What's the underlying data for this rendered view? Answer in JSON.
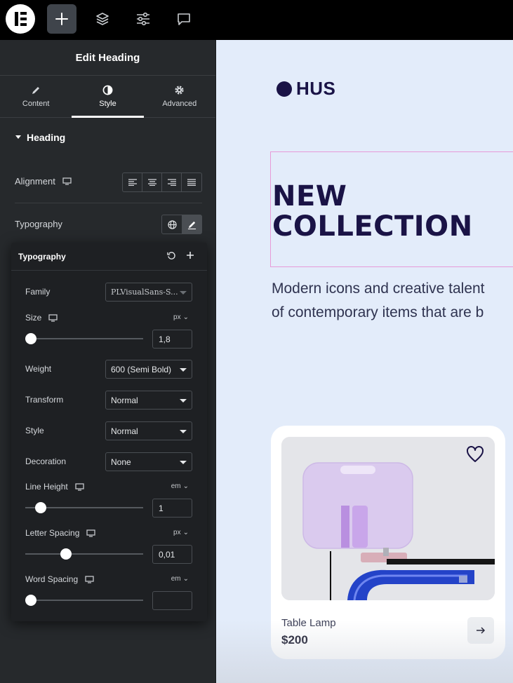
{
  "topbar": {
    "icons": [
      "elementor-logo-icon",
      "plus-icon",
      "layers-icon",
      "sliders-icon",
      "comment-icon"
    ]
  },
  "panel": {
    "title": "Edit Heading",
    "tabs": [
      {
        "label": "Content",
        "icon": "pencil-icon"
      },
      {
        "label": "Style",
        "icon": "half-circle-icon"
      },
      {
        "label": "Advanced",
        "icon": "gear-icon"
      }
    ],
    "section": {
      "title": "Heading"
    },
    "alignment_label": "Alignment",
    "typography_label": "Typography"
  },
  "typography": {
    "title": "Typography",
    "family": {
      "label": "Family",
      "value": "PLVisualSans-S..."
    },
    "size": {
      "label": "Size",
      "unit": "px",
      "value": "1,8",
      "level": 0
    },
    "weight": {
      "label": "Weight",
      "value": "600 (Semi Bold)"
    },
    "transform": {
      "label": "Transform",
      "value": "Normal"
    },
    "style": {
      "label": "Style",
      "value": "Normal"
    },
    "decoration": {
      "label": "Decoration",
      "value": "None"
    },
    "line_height": {
      "label": "Line Height",
      "unit": "em",
      "value": "1",
      "level": 0.09
    },
    "letter_spacing": {
      "label": "Letter Spacing",
      "unit": "px",
      "value": "0,01",
      "level": 0.33
    },
    "word_spacing": {
      "label": "Word Spacing",
      "unit": "em",
      "value": "",
      "level": 0
    }
  },
  "canvas": {
    "brand": "HUS",
    "heading_line1": "NEW",
    "heading_line2": "COLLECTION",
    "subtitle_line1": "Modern icons and creative talent",
    "subtitle_line2": "of contemporary items that are b",
    "product": {
      "name": "Table Lamp",
      "price": "$200"
    }
  },
  "colors": {
    "panel_bg": "#26292c",
    "canvas_bg": "#e3ecfa",
    "brand_navy": "#1a1346",
    "selection_outline": "#e79ad8"
  }
}
